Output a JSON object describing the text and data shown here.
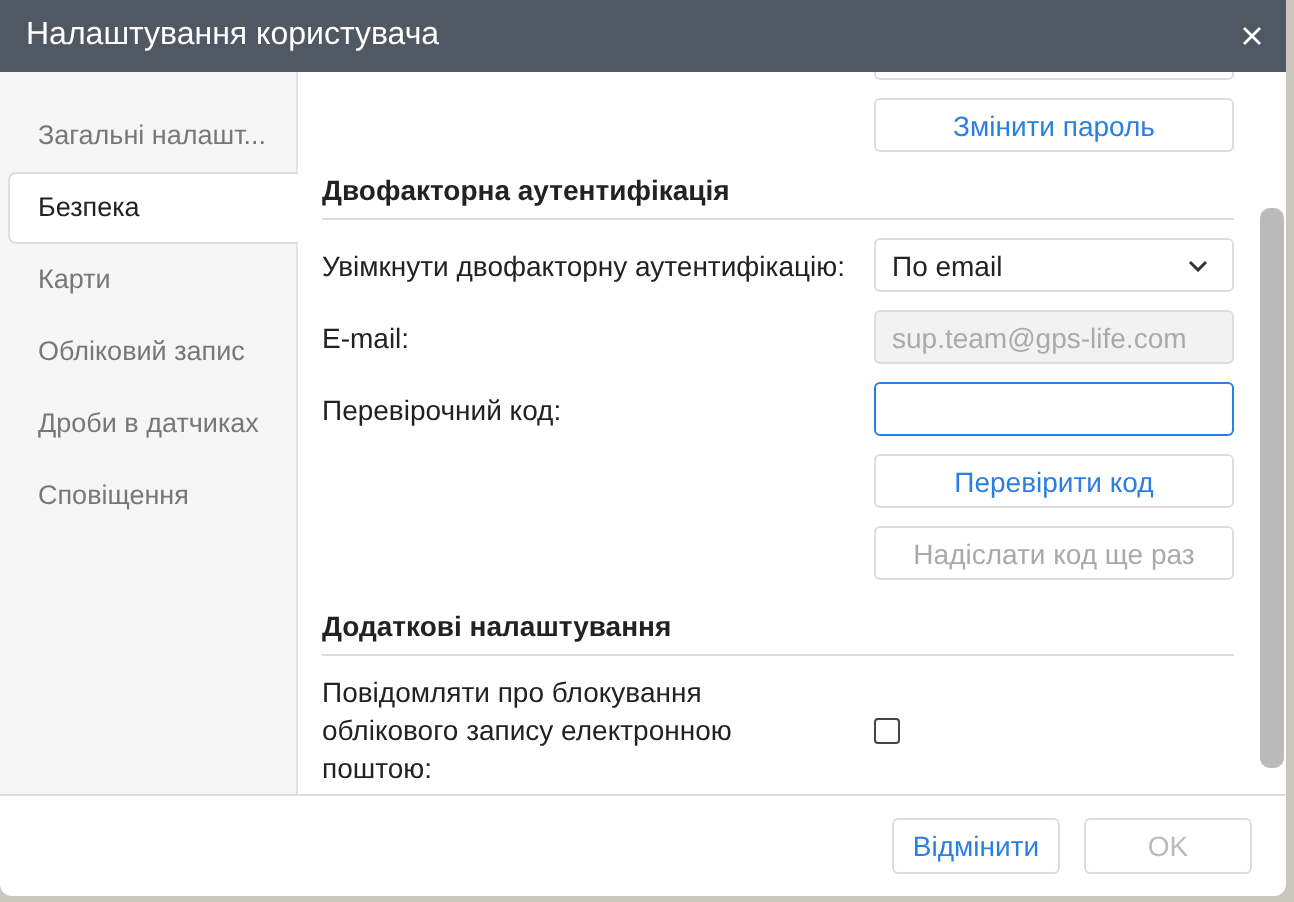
{
  "window": {
    "title": "Налаштування користувача"
  },
  "sidebar": {
    "items": [
      {
        "label": "Загальні налашт...",
        "selected": false
      },
      {
        "label": "Безпека",
        "selected": true
      },
      {
        "label": "Карти",
        "selected": false
      },
      {
        "label": "Обліковий запис",
        "selected": false
      },
      {
        "label": "Дроби в датчиках",
        "selected": false
      },
      {
        "label": "Сповіщення",
        "selected": false
      }
    ]
  },
  "change_password_button": {
    "label": "Змінити пароль",
    "disabled": false
  },
  "two_factor": {
    "heading": "Двофакторна аутентифікація",
    "rows": [
      {
        "kind": "select",
        "label": "Увімкнути двофакторну аутентифікацію:",
        "value": "По email",
        "disabled": false
      },
      {
        "kind": "field",
        "label": "E-mail:",
        "value": "sup.team@gps-life.com",
        "disabled": true
      },
      {
        "kind": "field",
        "label": "Перевірочний код:",
        "value": "",
        "disabled": false,
        "focused": true
      },
      {
        "kind": "button",
        "label": "Перевірити код",
        "disabled": false
      },
      {
        "kind": "button",
        "label": "Надіслати код ще раз",
        "disabled": true
      }
    ]
  },
  "additional": {
    "heading": "Додаткові налаштування",
    "notify": {
      "label": "Повідомляти про блокування облікового запису електронною поштою:",
      "checked": false
    }
  },
  "buttons": [
    {
      "label": "Відмінити",
      "disabled": false
    },
    {
      "label": "OK",
      "disabled": true
    }
  ]
}
